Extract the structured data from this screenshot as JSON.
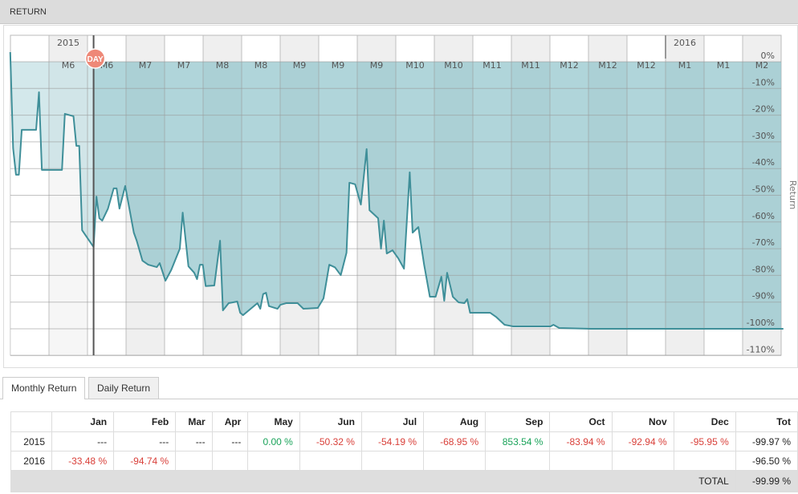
{
  "header": {
    "title": "RETURN"
  },
  "chart_data": {
    "type": "area",
    "ylabel": "Return",
    "ylim": [
      -110,
      0
    ],
    "yticks": [
      "0%",
      "-10%",
      "-20%",
      "-30%",
      "-40%",
      "-50%",
      "-60%",
      "-70%",
      "-80%",
      "-90%",
      "-100%",
      "-110%"
    ],
    "xlim": [
      "2015-05-18",
      "2016-02-11"
    ],
    "year_labels": [
      "2015",
      "2016"
    ],
    "month_labels": [
      "M6",
      "M6",
      "M7",
      "M7",
      "M8",
      "M8",
      "M9",
      "M9",
      "M9",
      "M10",
      "M10",
      "M11",
      "M11",
      "M12",
      "M12",
      "M12",
      "M1",
      "M1",
      "M2"
    ],
    "marker": {
      "label": "DAY",
      "date": "2015-06-16",
      "color": "#ee8877"
    },
    "line_color": "#3f8f99",
    "fill_color": "#8fc3ca",
    "grid": true,
    "points": [
      [
        "2015-05-18",
        3.6
      ],
      [
        "2015-05-19",
        -32.4
      ],
      [
        "2015-05-20",
        -42.3
      ],
      [
        "2015-05-21",
        -42.3
      ],
      [
        "2015-05-22",
        -25.5
      ],
      [
        "2015-05-27",
        -25.5
      ],
      [
        "2015-05-28",
        -11.4
      ],
      [
        "2015-05-29",
        -40.5
      ],
      [
        "2015-06-05",
        -40.5
      ],
      [
        "2015-06-06",
        -19.5
      ],
      [
        "2015-06-09",
        -20.4
      ],
      [
        "2015-06-10",
        -31.5
      ],
      [
        "2015-06-11",
        -31.5
      ],
      [
        "2015-06-12",
        -63.1
      ],
      [
        "2015-06-16",
        -69.4
      ],
      [
        "2015-06-17",
        -50.5
      ],
      [
        "2015-06-18",
        -58.6
      ],
      [
        "2015-06-19",
        -59.5
      ],
      [
        "2015-06-21",
        -55
      ],
      [
        "2015-06-23",
        -47.4
      ],
      [
        "2015-06-24",
        -47.4
      ],
      [
        "2015-06-25",
        -55
      ],
      [
        "2015-06-27",
        -46.5
      ],
      [
        "2015-06-30",
        -64
      ],
      [
        "2015-07-01",
        -67
      ],
      [
        "2015-07-03",
        -74.5
      ],
      [
        "2015-07-05",
        -76
      ],
      [
        "2015-07-08",
        -76.9
      ],
      [
        "2015-07-09",
        -75.4
      ],
      [
        "2015-07-11",
        -82
      ],
      [
        "2015-07-13",
        -78
      ],
      [
        "2015-07-16",
        -70
      ],
      [
        "2015-07-17",
        -56.5
      ],
      [
        "2015-07-19",
        -76.6
      ],
      [
        "2015-07-21",
        -79
      ],
      [
        "2015-07-22",
        -81.4
      ],
      [
        "2015-07-23",
        -76
      ],
      [
        "2015-07-24",
        -76
      ],
      [
        "2015-07-25",
        -84
      ],
      [
        "2015-07-28",
        -83.8
      ],
      [
        "2015-07-29",
        -75.5
      ],
      [
        "2015-07-30",
        -67
      ],
      [
        "2015-07-31",
        -93.1
      ],
      [
        "2015-08-02",
        -90.4
      ],
      [
        "2015-08-05",
        -89.8
      ],
      [
        "2015-08-06",
        -94
      ],
      [
        "2015-08-07",
        -94.9
      ],
      [
        "2015-08-12",
        -90.4
      ],
      [
        "2015-08-13",
        -92.5
      ],
      [
        "2015-08-14",
        -87
      ],
      [
        "2015-08-15",
        -86.5
      ],
      [
        "2015-08-16",
        -91.5
      ],
      [
        "2015-08-19",
        -92.5
      ],
      [
        "2015-08-20",
        -91
      ],
      [
        "2015-08-22",
        -90.4
      ],
      [
        "2015-08-26",
        -90.4
      ],
      [
        "2015-08-28",
        -92.5
      ],
      [
        "2015-09-02",
        -92.2
      ],
      [
        "2015-09-04",
        -88.6
      ],
      [
        "2015-09-06",
        -76
      ],
      [
        "2015-09-08",
        -77
      ],
      [
        "2015-09-10",
        -79.9
      ],
      [
        "2015-09-12",
        -71.5
      ],
      [
        "2015-09-13",
        -45.3
      ],
      [
        "2015-09-15",
        -45.9
      ],
      [
        "2015-09-17",
        -53.5
      ],
      [
        "2015-09-19",
        -32.7
      ],
      [
        "2015-09-20",
        -55.6
      ],
      [
        "2015-09-23",
        -58.6
      ],
      [
        "2015-09-24",
        -70
      ],
      [
        "2015-09-25",
        -59.5
      ],
      [
        "2015-09-26",
        -71.8
      ],
      [
        "2015-09-28",
        -70.6
      ],
      [
        "2015-09-30",
        -73.6
      ],
      [
        "2015-10-02",
        -77.5
      ],
      [
        "2015-10-04",
        -41.4
      ],
      [
        "2015-10-05",
        -64
      ],
      [
        "2015-10-07",
        -61.9
      ],
      [
        "2015-10-09",
        -76
      ],
      [
        "2015-10-11",
        -88
      ],
      [
        "2015-10-13",
        -88
      ],
      [
        "2015-10-15",
        -80.5
      ],
      [
        "2015-10-16",
        -89.5
      ],
      [
        "2015-10-17",
        -79
      ],
      [
        "2015-10-19",
        -88
      ],
      [
        "2015-10-21",
        -90.1
      ],
      [
        "2015-10-23",
        -90.4
      ],
      [
        "2015-10-24",
        -88.9
      ],
      [
        "2015-10-25",
        -94
      ],
      [
        "2015-11-01",
        -94
      ],
      [
        "2015-11-03",
        -95.5
      ],
      [
        "2015-11-06",
        -98.5
      ],
      [
        "2015-11-09",
        -99.1
      ],
      [
        "2015-11-22",
        -99.1
      ],
      [
        "2015-11-23",
        -98.5
      ],
      [
        "2015-11-25",
        -99.7
      ],
      [
        "2015-12-06",
        -100
      ],
      [
        "2016-02-11",
        -100
      ]
    ]
  },
  "tabs": [
    "Monthly Return",
    "Daily Return"
  ],
  "table": {
    "headers": [
      "",
      "Jan",
      "Feb",
      "Mar",
      "Apr",
      "May",
      "Jun",
      "Jul",
      "Aug",
      "Sep",
      "Oct",
      "Nov",
      "Dec",
      "Tot"
    ],
    "rows": [
      [
        "2015",
        "---",
        "---",
        "---",
        "---",
        "0.00 %",
        "-50.32 %",
        "-54.19 %",
        "-68.95 %",
        "853.54 %",
        "-83.94 %",
        "-92.94 %",
        "-95.95 %",
        "-99.97 %"
      ],
      [
        "2016",
        "-33.48 %",
        "-94.74 %",
        "",
        "",
        "",
        "",
        "",
        "",
        "",
        "",
        "",
        "",
        "-96.50 %"
      ]
    ],
    "total_label": "TOTAL",
    "total_value": "-99.99 %"
  }
}
